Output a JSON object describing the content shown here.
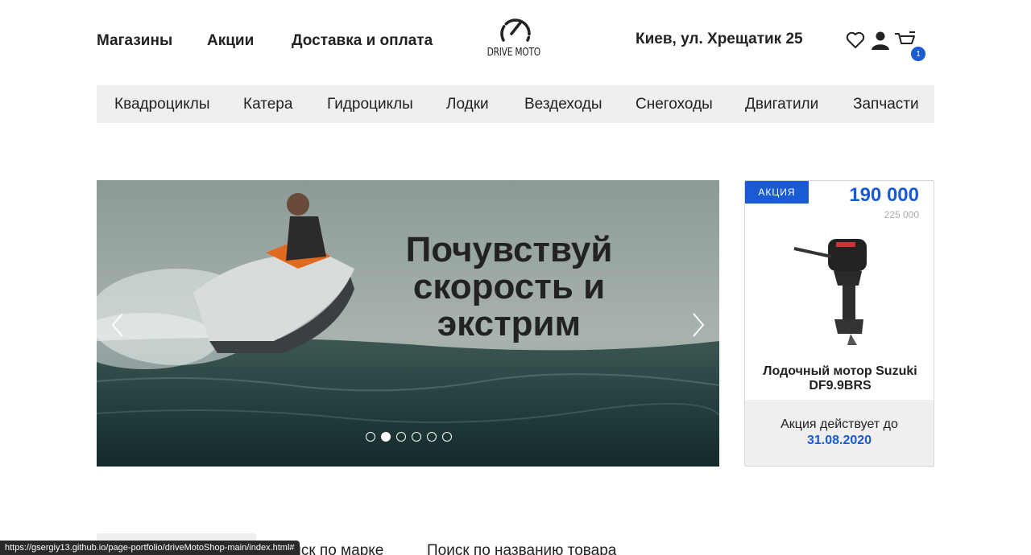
{
  "header": {
    "links": [
      "Магазины",
      "Акции",
      "Доставка и оплата"
    ],
    "logo_text": "DRIVE MOTO",
    "address": "Киев, ул. Хрещатик 25",
    "cart_count": "1"
  },
  "categories": [
    "Квадроциклы",
    "Катера",
    "Гидроциклы",
    "Лодки",
    "Вездеходы",
    "Снегоходы",
    "Двигатили",
    "Запчасти"
  ],
  "slider": {
    "title_line1": "Почувствуй",
    "title_line2": "скорость и",
    "title_line3": "экстрим",
    "active_index": 1,
    "dot_count": 6
  },
  "promo": {
    "badge": "АКЦИЯ",
    "price": "190 000",
    "old_price": "225 000",
    "product_name": "Лодочный мотор Suzuki DF9.9BRS",
    "until_label": "Акция действует до",
    "until_date": "31.08.2020"
  },
  "search": {
    "tab_brand": "Поиск по марке",
    "tab_name": "Поиск по названию товара"
  },
  "statusbar": {
    "url": "https://gsergiy13.github.io/page-portfolio/driveMotoShop-main/index.html#"
  },
  "colors": {
    "accent": "#1a5bd4",
    "nav_bg": "#efefef"
  },
  "icons": [
    "heart-icon",
    "user-icon",
    "cart-icon",
    "chevron-left-icon",
    "chevron-right-icon",
    "speedometer-logo-icon"
  ]
}
